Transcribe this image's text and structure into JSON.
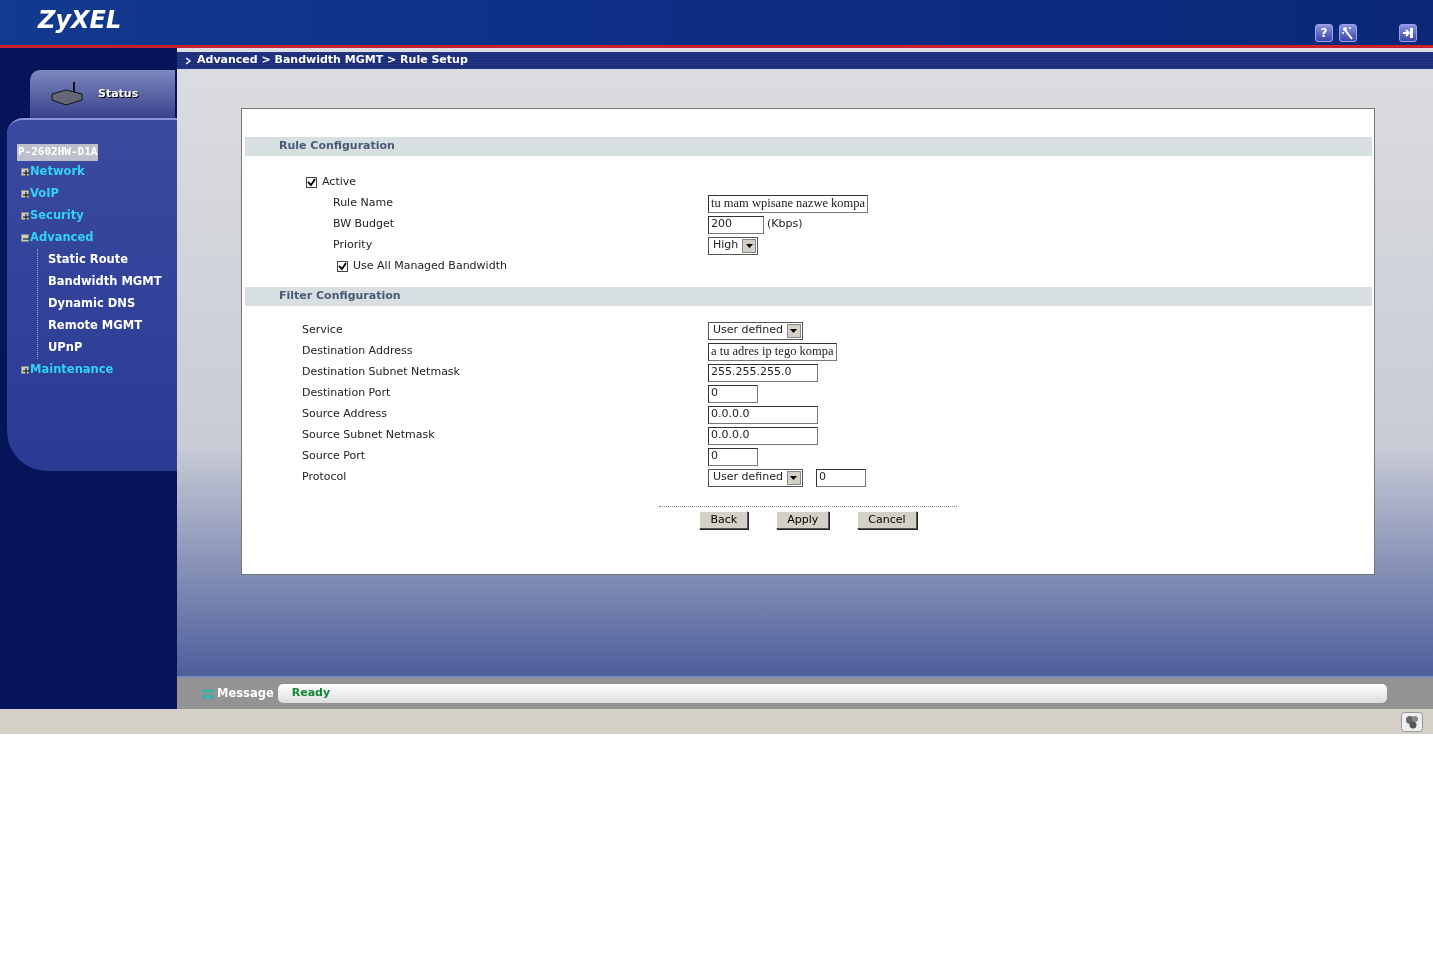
{
  "header": {
    "logo": "ZyXEL",
    "help_glyph": "?"
  },
  "sidebar": {
    "status_tab": "Status",
    "device": "P-2602HW-D1A",
    "items": [
      {
        "label": "Network",
        "expanded": false
      },
      {
        "label": "VoIP",
        "expanded": false
      },
      {
        "label": "Security",
        "expanded": false
      },
      {
        "label": "Advanced",
        "expanded": true,
        "children": [
          {
            "label": "Static Route"
          },
          {
            "label": "Bandwidth MGMT"
          },
          {
            "label": "Dynamic DNS"
          },
          {
            "label": "Remote MGMT"
          },
          {
            "label": "UPnP"
          }
        ]
      },
      {
        "label": "Maintenance",
        "expanded": false
      }
    ]
  },
  "breadcrumb": "Advanced > Bandwidth MGMT > Rule Setup",
  "rule_config": {
    "title": "Rule Configuration",
    "active": {
      "label": "Active",
      "checked": true
    },
    "fields": [
      {
        "kind": "note",
        "label": "Rule Name",
        "value": "tu mam wpisane nazwe kompa"
      },
      {
        "kind": "text",
        "label": "BW Budget",
        "value": "200",
        "unit": "(Kbps)"
      },
      {
        "kind": "select",
        "label": "Priority",
        "value": "High"
      }
    ],
    "use_all": {
      "label": "Use All Managed Bandwidth",
      "checked": true
    }
  },
  "filter_config": {
    "title": "Filter Configuration",
    "fields": [
      {
        "kind": "select",
        "label": "Service",
        "value": "User defined"
      },
      {
        "kind": "note",
        "label": "Destination Address",
        "value": "a tu adres ip tego kompa"
      },
      {
        "kind": "text",
        "label": "Destination Subnet Netmask",
        "value": "255.255.255.0"
      },
      {
        "kind": "short",
        "label": "Destination Port",
        "value": "0"
      },
      {
        "kind": "text",
        "label": "Source Address",
        "value": "0.0.0.0"
      },
      {
        "kind": "text",
        "label": "Source Subnet Netmask",
        "value": "0.0.0.0"
      },
      {
        "kind": "short",
        "label": "Source Port",
        "value": "0"
      },
      {
        "kind": "select",
        "label": "Protocol",
        "value": "User defined",
        "extra_value": "0"
      }
    ]
  },
  "buttons": [
    "Back",
    "Apply",
    "Cancel"
  ],
  "message": {
    "label": "Message",
    "text": "Ready"
  }
}
